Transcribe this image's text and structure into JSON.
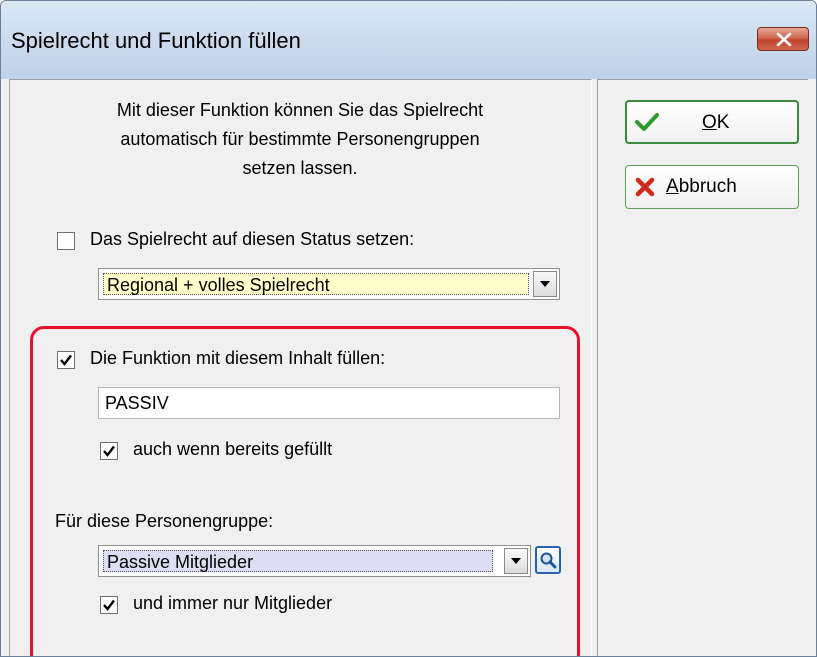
{
  "window": {
    "title": "Spielrecht und Funktion füllen"
  },
  "intro": {
    "line1": "Mit dieser Funktion können Sie das Spielrecht",
    "line2": "automatisch für bestimmte Personengruppen",
    "line3": "setzen lassen."
  },
  "status": {
    "checkbox_label": "Das Spielrecht auf diesen Status setzen:",
    "checked": false,
    "select_value": "Regional + volles Spielrecht"
  },
  "funktion": {
    "checkbox_label": "Die Funktion mit diesem Inhalt füllen:",
    "checked": true,
    "input_value": "PASSIV",
    "overwrite_label": "auch wenn bereits gefüllt",
    "overwrite_checked": true
  },
  "gruppe": {
    "label": "Für diese Personengruppe:",
    "select_value": "Passive Mitglieder",
    "members_only_label": "und immer nur Mitglieder",
    "members_only_checked": true
  },
  "buttons": {
    "ok_label_underlined": "O",
    "ok_label_rest": "K",
    "cancel_label_underlined": "A",
    "cancel_label_rest": "bbruch"
  },
  "colors": {
    "highlight": "#e8102a",
    "status_select_bg": "#ffffcc",
    "group_select_bg": "#ddddf4",
    "ok_check": "#2e9a2e",
    "cancel_x": "#d22a1a"
  },
  "icons": {
    "close": "close-icon",
    "check": "checkmark-icon",
    "cancel": "cross-icon",
    "dropdown": "chevron-down-icon",
    "search": "magnifier-icon"
  }
}
